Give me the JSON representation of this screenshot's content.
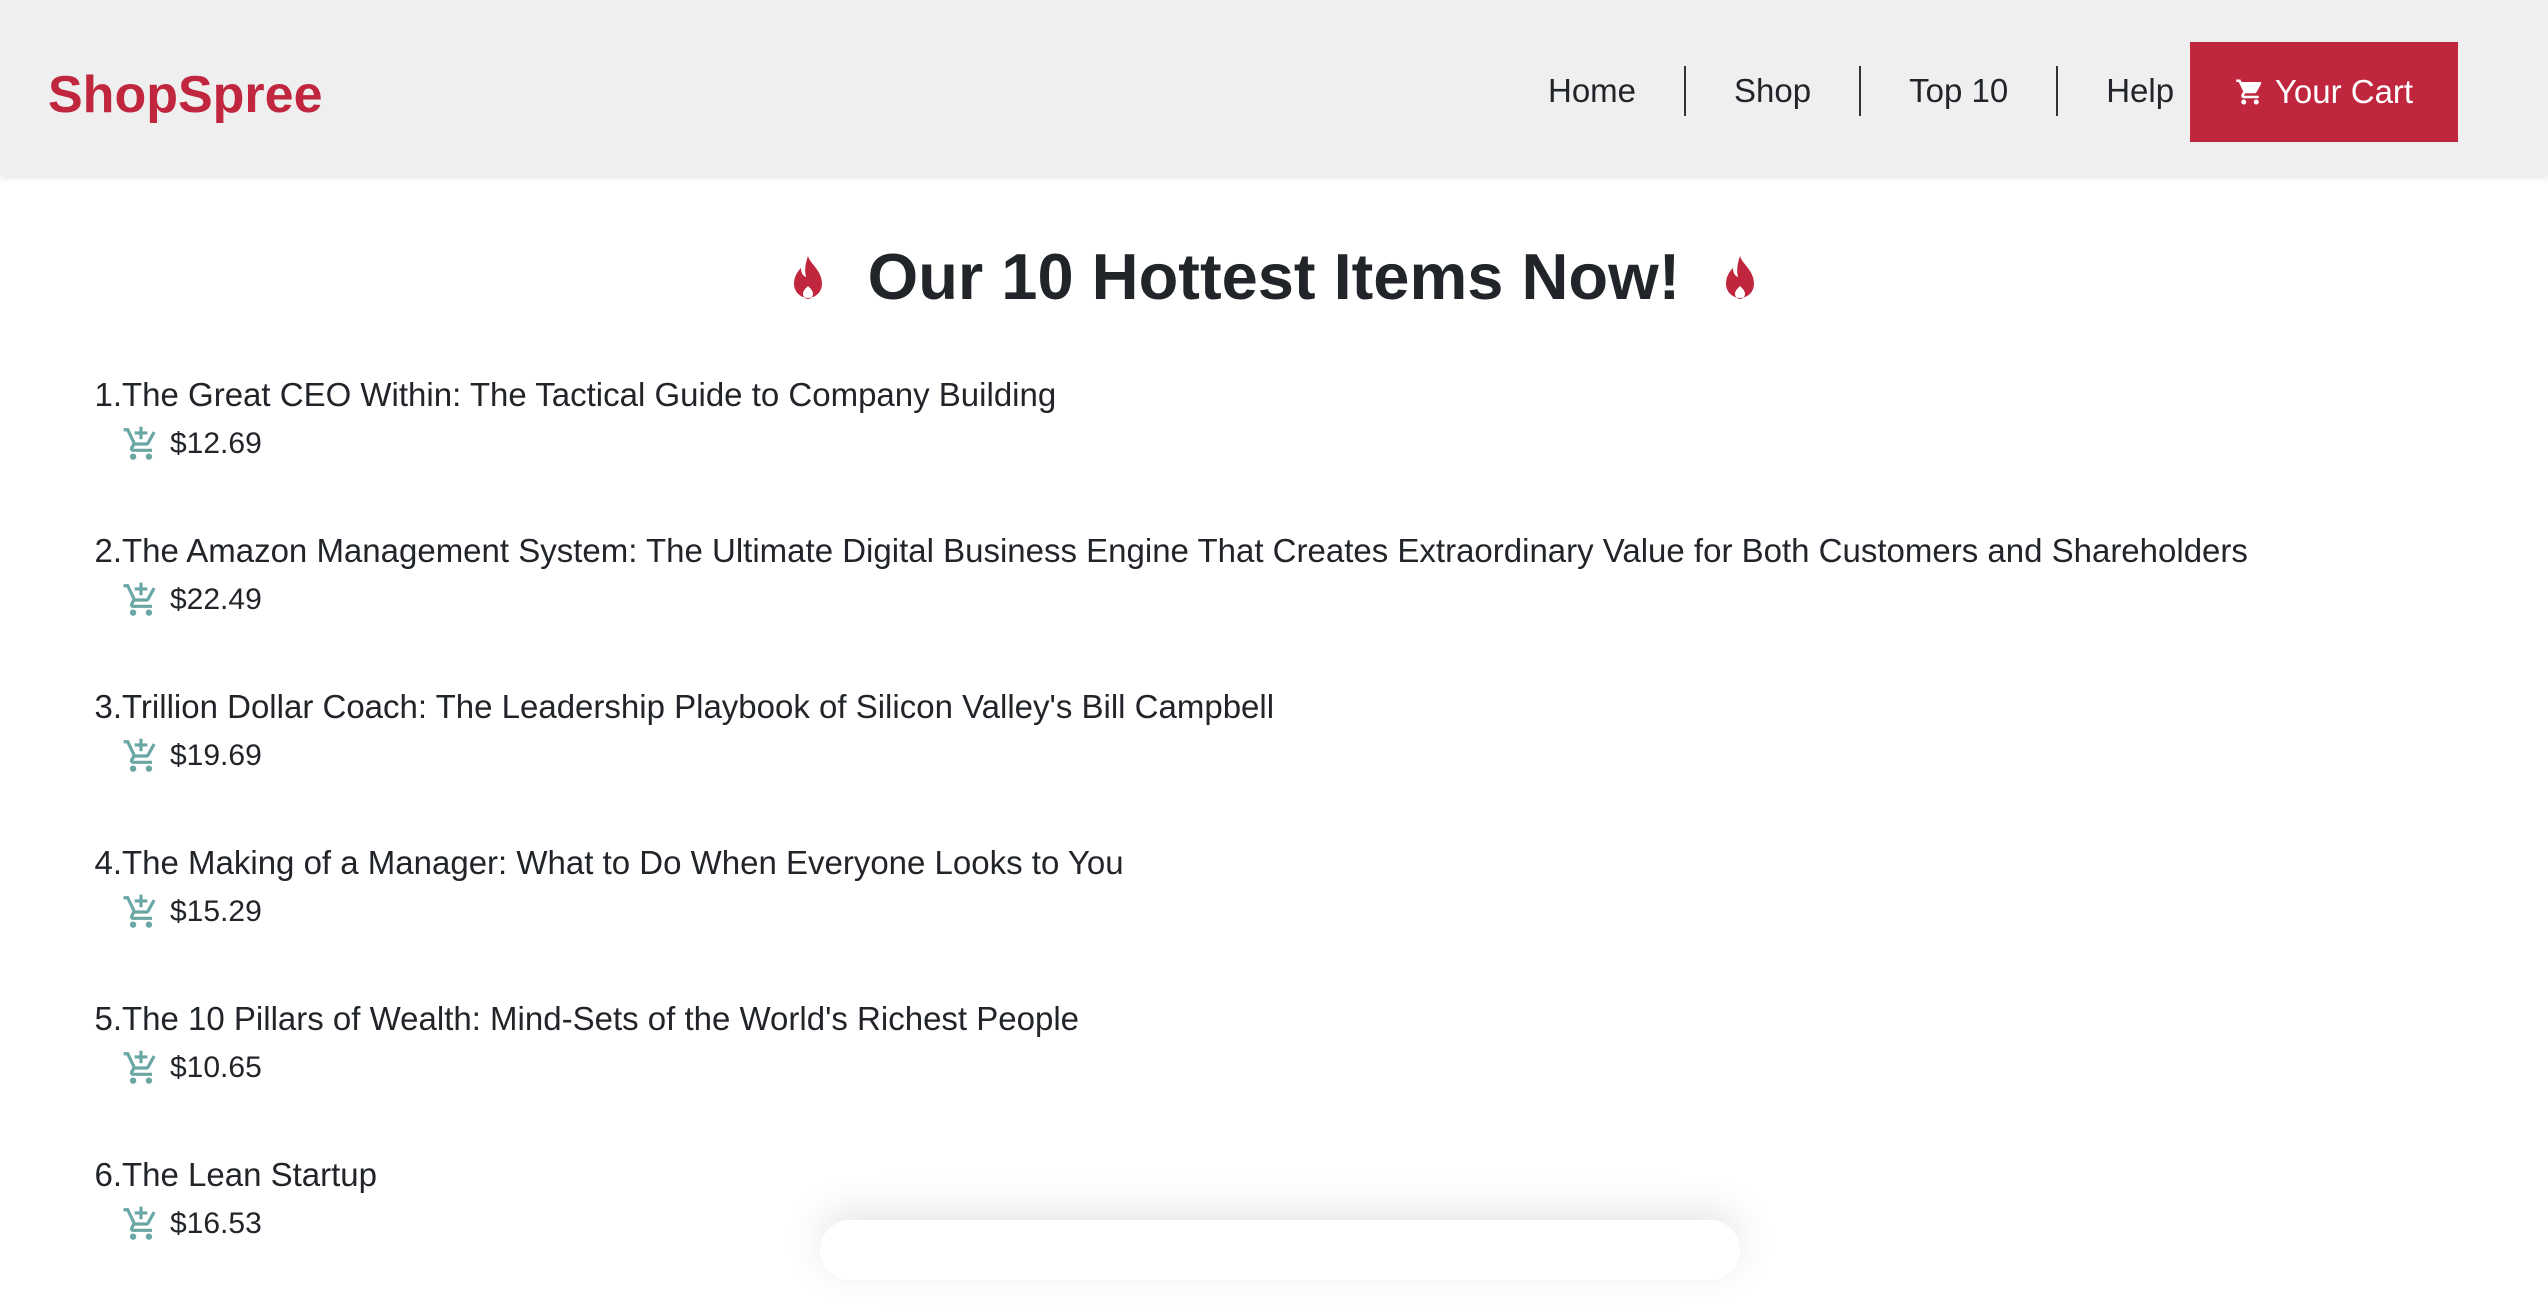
{
  "brand": "ShopSpree",
  "nav": {
    "links": [
      "Home",
      "Shop",
      "Top 10",
      "Help"
    ],
    "cart_label": "Your Cart"
  },
  "heading": "Our 10 Hottest Items Now!",
  "colors": {
    "accent": "#c0263d",
    "navbar_bg": "#efefef",
    "add_to_cart_icon": "#6aa6a3"
  },
  "icons": {
    "heading": "fire-icon",
    "cart_button": "shopping-cart-icon",
    "item_action": "add-to-cart-icon"
  },
  "products": [
    {
      "rank": "1.",
      "title": "The Great CEO Within: The Tactical Guide to Company Building",
      "price": "$12.69"
    },
    {
      "rank": "2.",
      "title": "The Amazon Management System: The Ultimate Digital Business Engine That Creates Extraordinary Value for Both Customers and Shareholders",
      "price": "$22.49"
    },
    {
      "rank": "3.",
      "title": "Trillion Dollar Coach: The Leadership Playbook of Silicon Valley's Bill Campbell",
      "price": "$19.69"
    },
    {
      "rank": "4.",
      "title": "The Making of a Manager: What to Do When Everyone Looks to You",
      "price": "$15.29"
    },
    {
      "rank": "5.",
      "title": "The 10 Pillars of Wealth: Mind-Sets of the World's Richest People",
      "price": "$10.65"
    },
    {
      "rank": "6.",
      "title": "The Lean Startup",
      "price": "$16.53"
    }
  ]
}
